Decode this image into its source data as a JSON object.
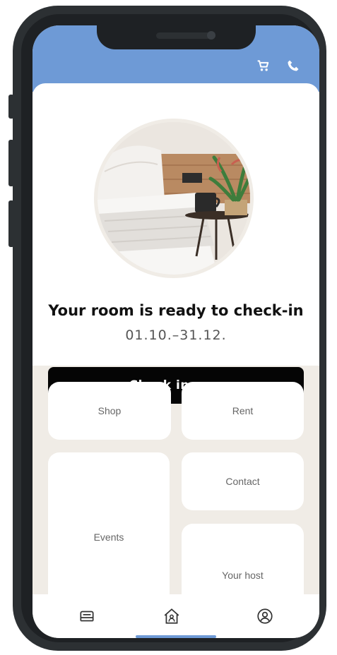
{
  "header": {
    "icons": [
      "cart-icon",
      "phone-icon"
    ],
    "accent_color": "#6e9ad6"
  },
  "booking": {
    "title": "Your room is ready to check-in",
    "dates": "01.10.–31.12.",
    "cta_label": "Check in now"
  },
  "tiles": [
    {
      "label": "Shop"
    },
    {
      "label": "Rent"
    },
    {
      "label": "Events"
    },
    {
      "label": "Contact"
    },
    {
      "label": "Your host"
    }
  ],
  "bottom_nav": {
    "items": [
      "bed-icon",
      "home-icon",
      "profile-icon"
    ],
    "active": "home-icon"
  }
}
